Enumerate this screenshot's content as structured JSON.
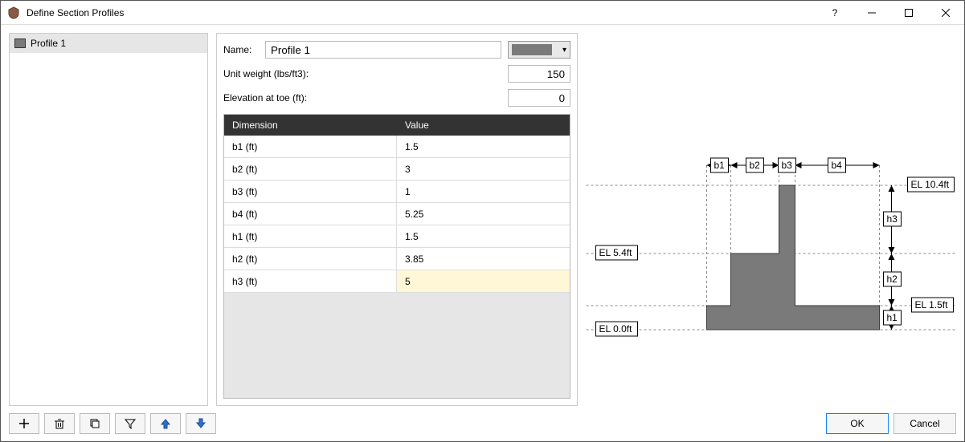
{
  "window": {
    "title": "Define Section Profiles"
  },
  "sidebar": {
    "profiles": [
      {
        "name": "Profile 1",
        "color": "#7a7a7a"
      }
    ]
  },
  "form": {
    "name_label": "Name:",
    "name_value": "Profile 1",
    "unit_weight_label": "Unit weight (lbs/ft3):",
    "unit_weight_value": "150",
    "elev_toe_label": "Elevation at toe (ft):",
    "elev_toe_value": "0"
  },
  "grid": {
    "headers": {
      "dim": "Dimension",
      "val": "Value"
    },
    "rows": [
      {
        "dim": "b1 (ft)",
        "val": "1.5"
      },
      {
        "dim": "b2 (ft)",
        "val": "3"
      },
      {
        "dim": "b3 (ft)",
        "val": "1"
      },
      {
        "dim": "b4 (ft)",
        "val": "5.25"
      },
      {
        "dim": "h1 (ft)",
        "val": "1.5"
      },
      {
        "dim": "h2 (ft)",
        "val": "3.85"
      },
      {
        "dim": "h3 (ft)",
        "val": "5"
      }
    ],
    "selected_index": 6
  },
  "diagram": {
    "b_labels": [
      "b1",
      "b2",
      "b3",
      "b4"
    ],
    "h_labels": [
      "h1",
      "h2",
      "h3"
    ],
    "el_labels": [
      "EL 0.0ft",
      "EL 1.5ft",
      "EL 5.4ft",
      "EL 10.4ft"
    ]
  },
  "toolbar": {
    "add": "+",
    "delete": "🗑",
    "copy": "⧉",
    "filter": "⌄",
    "up": "▲",
    "down": "▼"
  },
  "buttons": {
    "ok": "OK",
    "cancel": "Cancel"
  }
}
